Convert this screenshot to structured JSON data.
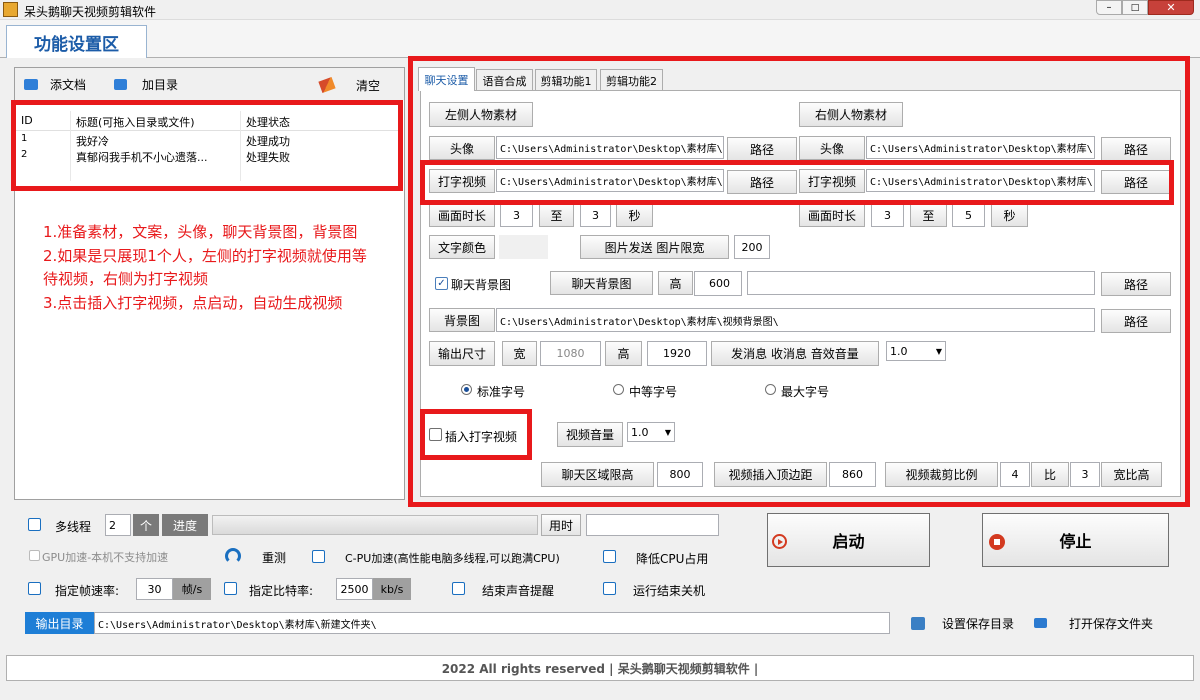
{
  "window": {
    "title": "呆头鹅聊天视频剪辑软件"
  },
  "header_tab": "功能设置区",
  "left": {
    "add_doc": "添文档",
    "add_dir": "加目录",
    "clear": "清空",
    "columns": [
      "ID",
      "标题(可拖入目录或文件)",
      "处理状态"
    ],
    "rows": [
      {
        "id": "1",
        "title": "我好冷",
        "status": "处理成功"
      },
      {
        "id": "2",
        "title": "真郁闷我手机不小心遗落...",
        "status": "处理失败"
      }
    ],
    "notes": [
      "1.准备素材，文案，头像，聊天背景图，背景图",
      "2.如果是只展现1个人，左侧的打字视频就使用等",
      "待视频，右侧为打字视频",
      "3.点击插入打字视频，点启动，自动生成视频"
    ]
  },
  "tabs": [
    "聊天设置",
    "语音合成",
    "剪辑功能1",
    "剪辑功能2"
  ],
  "chat": {
    "left_material": "左侧人物素材",
    "right_material": "右侧人物素材",
    "avatar": "头像",
    "typing_video": "打字视频",
    "path": "路径",
    "left_avatar_path": "C:\\Users\\Administrator\\Desktop\\素材库\\",
    "left_typing_path": "C:\\Users\\Administrator\\Desktop\\素材库\\",
    "right_avatar_path": "C:\\Users\\Administrator\\Desktop\\素材库\\",
    "right_typing_path": "C:\\Users\\Administrator\\Desktop\\素材库\\",
    "duration": "画面时长",
    "to": "至",
    "sec": "秒",
    "left_dur_from": "3",
    "left_dur_to": "3",
    "right_dur_from": "3",
    "right_dur_to": "5",
    "text_color": "文字颜色",
    "image_send": "图片发送 图片限宽",
    "image_width": "200",
    "chat_bg_check": "聊天背景图",
    "chat_bg_btn": "聊天背景图",
    "height": "高",
    "chat_bg_height": "600",
    "chat_bg_path": "",
    "bg_image": "背景图",
    "bg_path": "C:\\Users\\Administrator\\Desktop\\素材库\\视频背景图\\",
    "output_size": "输出尺寸",
    "width": "宽",
    "out_width": "1080",
    "out_height": "1920",
    "sound_vol": "发消息 收消息 音效音量",
    "sound_vol_value": "1.0",
    "font_std": "标准字号",
    "font_mid": "中等字号",
    "font_max": "最大字号",
    "insert_typing": "插入打字视频",
    "video_vol": "视频音量",
    "video_vol_value": "1.0",
    "chat_area_limit": "聊天区域限高",
    "chat_area_value": "800",
    "insert_top": "视频插入顶边距",
    "insert_top_value": "860",
    "crop_ratio": "视频裁剪比例",
    "crop_a": "4",
    "ratio": "比",
    "crop_b": "3",
    "wh_ratio": "宽比高"
  },
  "bottom": {
    "multithread": "多线程",
    "threads": "2",
    "unit": "个",
    "progress": "进度",
    "progress_value": 0,
    "time_used": "用时",
    "time_value": "",
    "start": "启动",
    "stop": "停止",
    "gpu": "GPU加速-本机不支持加速",
    "retest": "重测",
    "cpu": "C-PU加速(高性能电脑多线程,可以跑满CPU)",
    "lower_cpu": "降低CPU占用",
    "fps_label": "指定帧速率:",
    "fps": "30",
    "fps_unit": "帧/s",
    "bitrate_label": "指定比特率:",
    "bitrate": "2500",
    "bitrate_unit": "kb/s",
    "end_sound": "结束声音提醒",
    "shutdown": "运行结束关机",
    "out_dir_label": "输出目录",
    "out_dir": "C:\\Users\\Administrator\\Desktop\\素材库\\新建文件夹\\",
    "set_dir": "设置保存目录",
    "open_dir": "打开保存文件夹"
  },
  "footer": "2022 All rights reserved | 呆头鹅聊天视频剪辑软件 |"
}
